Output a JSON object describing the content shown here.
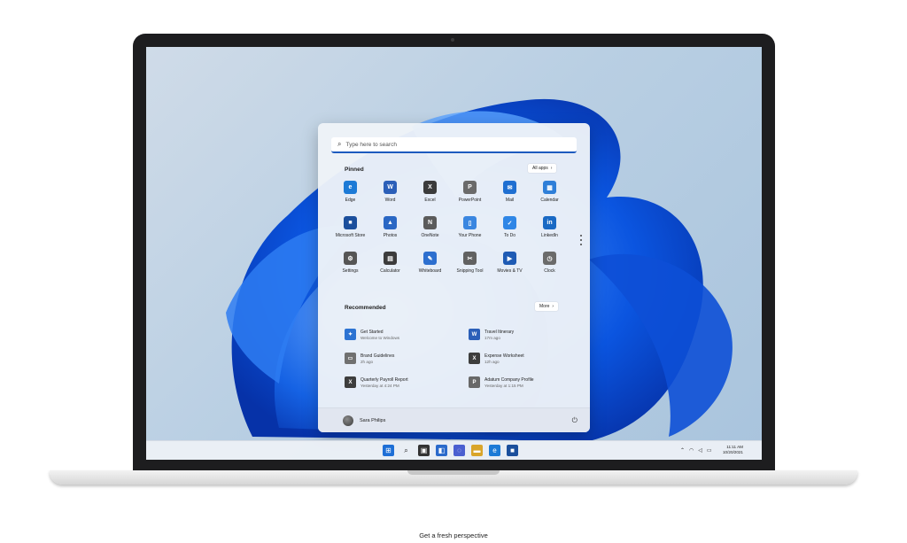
{
  "search": {
    "placeholder": "Type here to search"
  },
  "pinned": {
    "title": "Pinned",
    "all_apps": "All apps",
    "apps": [
      {
        "label": "Edge",
        "icon": "edge-icon",
        "color": "#1c7ad6",
        "glyph": "e"
      },
      {
        "label": "Word",
        "icon": "word-icon",
        "color": "#2b5fb8",
        "glyph": "W"
      },
      {
        "label": "Excel",
        "icon": "excel-icon",
        "color": "#3b3b3b",
        "glyph": "X"
      },
      {
        "label": "PowerPoint",
        "icon": "powerpoint-icon",
        "color": "#6a6a6a",
        "glyph": "P"
      },
      {
        "label": "Mail",
        "icon": "mail-icon",
        "color": "#1f6fd1",
        "glyph": "✉"
      },
      {
        "label": "Calendar",
        "icon": "calendar-icon",
        "color": "#2f7fd8",
        "glyph": "▦"
      },
      {
        "label": "Microsoft Store",
        "icon": "store-icon",
        "color": "#1b4f9c",
        "glyph": "■"
      },
      {
        "label": "Photos",
        "icon": "photos-icon",
        "color": "#2a67c4",
        "glyph": "▲"
      },
      {
        "label": "OneNote",
        "icon": "onenote-icon",
        "color": "#5b5b5b",
        "glyph": "N"
      },
      {
        "label": "Your Phone",
        "icon": "phone-icon",
        "color": "#3a86e0",
        "glyph": "▯"
      },
      {
        "label": "To Do",
        "icon": "todo-icon",
        "color": "#2f86e6",
        "glyph": "✓"
      },
      {
        "label": "LinkedIn",
        "icon": "linkedin-icon",
        "color": "#1969c4",
        "glyph": "in"
      },
      {
        "label": "Settings",
        "icon": "settings-icon",
        "color": "#555555",
        "glyph": "⚙"
      },
      {
        "label": "Calculator",
        "icon": "calculator-icon",
        "color": "#3c3c3c",
        "glyph": "▤"
      },
      {
        "label": "Whiteboard",
        "icon": "whiteboard-icon",
        "color": "#2d6fcf",
        "glyph": "✎"
      },
      {
        "label": "Snipping Tool",
        "icon": "snipping-tool-icon",
        "color": "#616161",
        "glyph": "✂"
      },
      {
        "label": "Movies & TV",
        "icon": "movies-icon",
        "color": "#1f5bb4",
        "glyph": "▶"
      },
      {
        "label": "Clock",
        "icon": "clock-icon",
        "color": "#6b6b6b",
        "glyph": "◷"
      }
    ]
  },
  "recommended": {
    "title": "Recommended",
    "more": "More",
    "items": [
      {
        "title": "Get Started",
        "subtitle": "Welcome to Windows",
        "icon": "get-started-icon",
        "color": "#2c73d2",
        "glyph": "✦"
      },
      {
        "title": "Travel Itinerary",
        "subtitle": "17m ago",
        "icon": "word-doc-icon",
        "color": "#2b5fb8",
        "glyph": "W"
      },
      {
        "title": "Brand Guidelines",
        "subtitle": "2h ago",
        "icon": "pdf-icon",
        "color": "#707070",
        "glyph": "▭"
      },
      {
        "title": "Expense Worksheet",
        "subtitle": "12h ago",
        "icon": "excel-doc-icon",
        "color": "#3d3d3d",
        "glyph": "X"
      },
      {
        "title": "Quarterly Payroll Report",
        "subtitle": "Yesterday at 4:24 PM",
        "icon": "excel-doc-icon",
        "color": "#3d3d3d",
        "glyph": "X"
      },
      {
        "title": "Adatum Company Profile",
        "subtitle": "Yesterday at 1:15 PM",
        "icon": "powerpoint-doc-icon",
        "color": "#686868",
        "glyph": "P"
      }
    ]
  },
  "user": {
    "name": "Sara Philips"
  },
  "taskbar": {
    "icons": [
      {
        "name": "start-icon",
        "color": "#1e6fd6",
        "glyph": "⊞"
      },
      {
        "name": "search-icon",
        "color": "#ffffff",
        "glyph": "⌕"
      },
      {
        "name": "task-view-icon",
        "color": "#333333",
        "glyph": "▣"
      },
      {
        "name": "widgets-icon",
        "color": "#2a6acb",
        "glyph": "◧"
      },
      {
        "name": "chat-icon",
        "color": "#4a5fd0",
        "glyph": "◌"
      },
      {
        "name": "file-explorer-icon",
        "color": "#d9a52a",
        "glyph": "▬"
      },
      {
        "name": "edge-icon",
        "color": "#1c7ad6",
        "glyph": "e"
      },
      {
        "name": "store-icon",
        "color": "#1b4f9c",
        "glyph": "■"
      }
    ]
  },
  "clock": {
    "time": "11:11 AM",
    "date": "10/20/2021"
  },
  "caption": "Get a fresh perspective"
}
